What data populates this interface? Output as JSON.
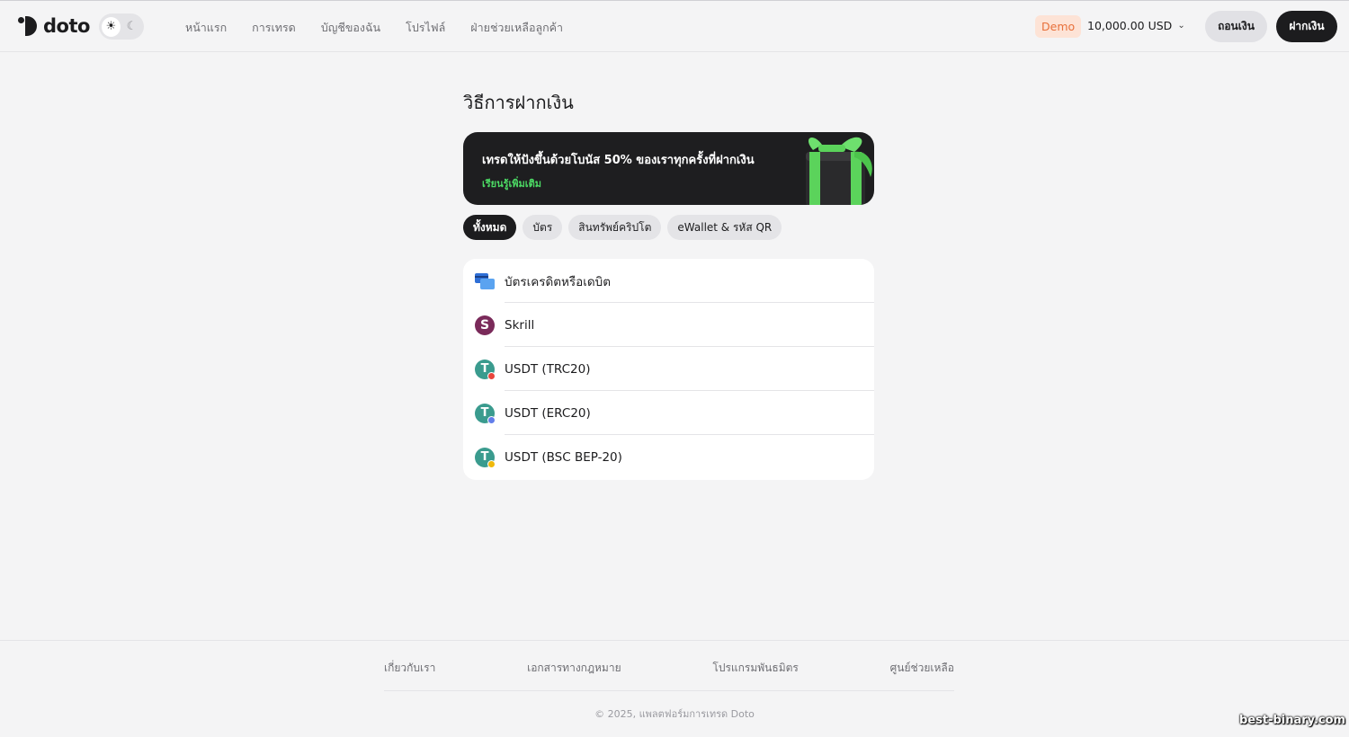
{
  "header": {
    "logo_text": "doto",
    "theme": {
      "light_icon": "sun-icon",
      "dark_icon": "moon-icon"
    },
    "nav": [
      {
        "label": "หน้าแรก"
      },
      {
        "label": "การเทรด"
      },
      {
        "label": "บัญชีของฉัน"
      },
      {
        "label": "โปรไฟล์"
      },
      {
        "label": "ฝ่ายช่วยเหลือลูกค้า"
      }
    ],
    "account_badge": "Demo",
    "balance": "10,000.00 USD",
    "withdraw_label": "ถอนเงิน",
    "deposit_label": "ฝากเงิน"
  },
  "main": {
    "title": "วิธีการฝากเงิน",
    "banner": {
      "text": "เทรดให้ปังขึ้นด้วยโบนัส 50% ของเราทุกครั้งที่ฝากเงิน",
      "link": "เรียนรู้เพิ่มเติม",
      "icon": "gift-icon"
    },
    "tabs": [
      {
        "label": "ทั้งหมด",
        "active": true
      },
      {
        "label": "บัตร",
        "active": false
      },
      {
        "label": "สินทรัพย์คริปโต",
        "active": false
      },
      {
        "label": "eWallet & รหัส QR",
        "active": false
      }
    ],
    "methods": [
      {
        "label": "บัตรเครดิตหรือเดบิต",
        "icon": "card-icon"
      },
      {
        "label": "Skrill",
        "icon": "skrill-icon"
      },
      {
        "label": "USDT (TRC20)",
        "icon": "usdt-trc20-icon",
        "network_color": "#e8453c"
      },
      {
        "label": "USDT (ERC20)",
        "icon": "usdt-erc20-icon",
        "network_color": "#627eea"
      },
      {
        "label": "USDT (BSC BEP-20)",
        "icon": "usdt-bep20-icon",
        "network_color": "#f0b90b"
      }
    ]
  },
  "footer": {
    "links": [
      {
        "label": "เกี่ยวกับเรา"
      },
      {
        "label": "เอกสารทางกฎหมาย"
      },
      {
        "label": "โปรแกรมพันธมิตร"
      },
      {
        "label": "ศูนย์ช่วยเหลือ"
      }
    ],
    "copyright": "© 2025, แพลตฟอร์มการเทรด Doto"
  },
  "watermark": "best-binary.com",
  "colors": {
    "accent_green": "#4cd964",
    "demo_badge_bg": "#fde3d6",
    "demo_badge_text": "#e8703a",
    "primary_dark": "#1c1c1e"
  }
}
